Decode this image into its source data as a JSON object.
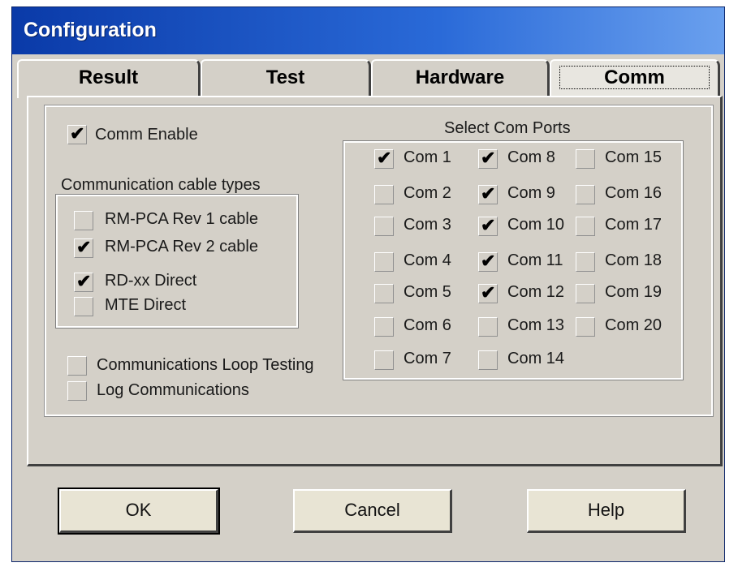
{
  "window": {
    "title": "Configuration"
  },
  "tabs": [
    {
      "label": "Result",
      "active": false
    },
    {
      "label": "Test",
      "active": false
    },
    {
      "label": "Hardware",
      "active": false
    },
    {
      "label": "Comm",
      "active": true
    }
  ],
  "comm": {
    "comm_enable": {
      "label": "Comm Enable",
      "checked": true
    },
    "cable_group_label": "Communication cable types",
    "cable_types": [
      {
        "label": "RM-PCA Rev 1 cable",
        "checked": false
      },
      {
        "label": "RM-PCA Rev 2 cable",
        "checked": true
      },
      {
        "label": "RD-xx Direct",
        "checked": true
      },
      {
        "label": "MTE Direct",
        "checked": false
      }
    ],
    "loop_testing": {
      "label": "Communications Loop Testing",
      "checked": false
    },
    "log_comms": {
      "label": "Log Communications",
      "checked": false
    },
    "ports_group_label": "Select Com Ports",
    "ports": [
      {
        "label": "Com 1",
        "checked": true
      },
      {
        "label": "Com 2",
        "checked": false
      },
      {
        "label": "Com 3",
        "checked": false
      },
      {
        "label": "Com 4",
        "checked": false
      },
      {
        "label": "Com 5",
        "checked": false
      },
      {
        "label": "Com 6",
        "checked": false
      },
      {
        "label": "Com 7",
        "checked": false
      },
      {
        "label": "Com 8",
        "checked": true
      },
      {
        "label": "Com 9",
        "checked": true
      },
      {
        "label": "Com 10",
        "checked": true
      },
      {
        "label": "Com 11",
        "checked": true
      },
      {
        "label": "Com 12",
        "checked": true
      },
      {
        "label": "Com 13",
        "checked": false
      },
      {
        "label": "Com 14",
        "checked": false
      },
      {
        "label": "Com 15",
        "checked": false
      },
      {
        "label": "Com 16",
        "checked": false
      },
      {
        "label": "Com 17",
        "checked": false
      },
      {
        "label": "Com 18",
        "checked": false
      },
      {
        "label": "Com 19",
        "checked": false
      },
      {
        "label": "Com 20",
        "checked": false
      }
    ]
  },
  "buttons": {
    "ok": "OK",
    "cancel": "Cancel",
    "help": "Help"
  },
  "colors": {
    "titlebar": "#0a3aa8",
    "face": "#d4d0c8",
    "button_face": "#e8e4d4"
  }
}
